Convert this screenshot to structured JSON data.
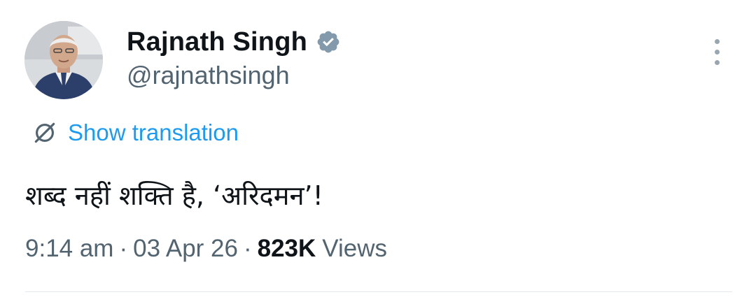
{
  "author": {
    "display_name": "Rajnath Singh",
    "handle": "@rajnathsingh",
    "verified": true,
    "badge_color": "#829aab"
  },
  "actions": {
    "more_icon": "more-vertical-icon"
  },
  "translation": {
    "icon": "translate-icon",
    "label": "Show translation",
    "color": "#1d9bf0"
  },
  "tweet": {
    "text": "शब्द नहीं शक्ति है, ‘अरिदमन’!"
  },
  "meta": {
    "time": "9:14 am",
    "separator": "·",
    "date": "03 Apr 26",
    "views_count": "823K",
    "views_label": "Views"
  }
}
